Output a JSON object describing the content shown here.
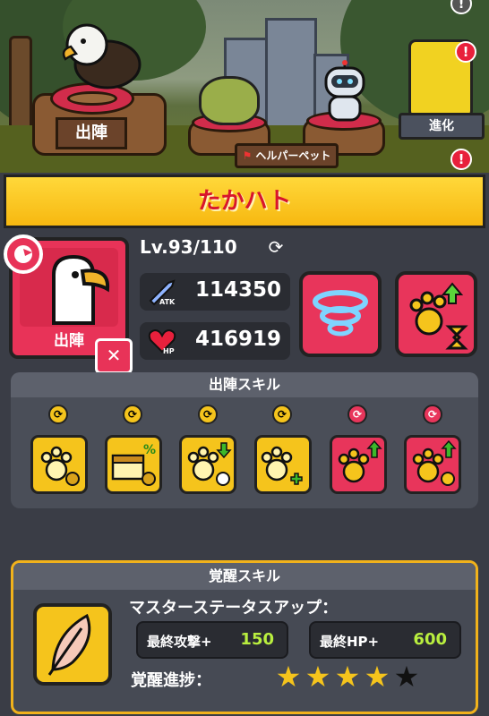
{
  "scene": {
    "deploy_label": "出陣",
    "helper_label": "ヘルパーペット",
    "evolve_label": "進化",
    "alert_mark": "!"
  },
  "pet": {
    "name": "たかハト",
    "portrait_label": "出陣",
    "level_text": "Lv.93/110",
    "atk_label": "ATK",
    "atk_value": "114350",
    "hp_label": "HP",
    "hp_value": "416919"
  },
  "deploy_skills": {
    "title": "出陣スキル",
    "skills": [
      {
        "icon": "paw-coin-icon",
        "color": "yellow",
        "status": "yellow"
      },
      {
        "icon": "chest-percent-icon",
        "color": "yellow",
        "status": "yellow"
      },
      {
        "icon": "paw-down-timer-icon",
        "color": "yellow",
        "status": "yellow"
      },
      {
        "icon": "paw-plus-icon",
        "color": "yellow",
        "status": "yellow"
      },
      {
        "icon": "paw-up-icon",
        "color": "red",
        "status": "red"
      },
      {
        "icon": "paw-up-gear-icon",
        "color": "red",
        "status": "red"
      }
    ]
  },
  "awakening": {
    "title": "覚醒スキル",
    "heading": "マスターステータスアップ：",
    "atk_bonus_label": "最終攻撃+",
    "atk_bonus_value": "150",
    "hp_bonus_label": "最終HP+",
    "hp_bonus_value": "600",
    "progress_label": "覚醒進捗：",
    "stars_filled": 4,
    "stars_total": 5
  },
  "colors": {
    "accent_yellow": "#f5c41c",
    "accent_red": "#e8355b",
    "bonus_green": "#b9ef3f",
    "title_red": "#d8152c"
  }
}
